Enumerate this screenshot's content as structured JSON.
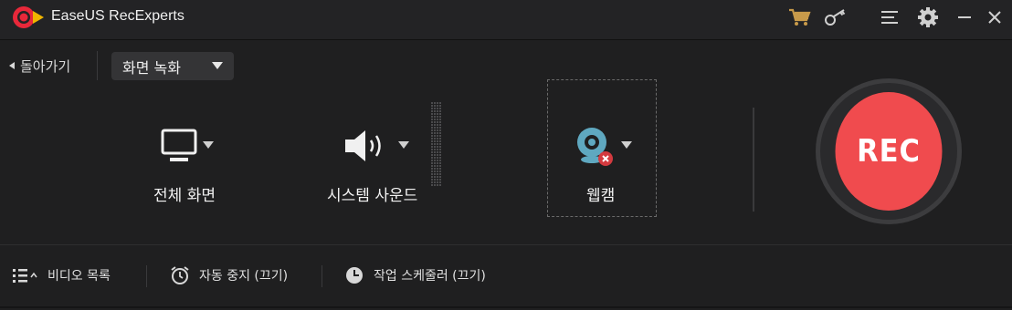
{
  "titlebar": {
    "app_title": "EaseUS RecExperts",
    "icons": [
      "logo-icon",
      "cart-icon",
      "key-icon",
      "menu-icon",
      "settings-icon",
      "minimize-icon",
      "close-icon"
    ],
    "accent_color": "#e8283a",
    "cart_color": "#c89a4a"
  },
  "toolbar": {
    "back_label": "돌아가기",
    "mode_value": "화면 녹화"
  },
  "options": {
    "screen_label": "전체 화면",
    "audio_label": "시스템 사운드",
    "webcam_label": "웹캠"
  },
  "rec": {
    "label": "REC",
    "color": "#f04b4e"
  },
  "bottom": {
    "video_list_label": "비디오 목록",
    "auto_stop_label": "자동 중지 (끄기)",
    "scheduler_label": "작업 스케줄러 (끄기)"
  }
}
